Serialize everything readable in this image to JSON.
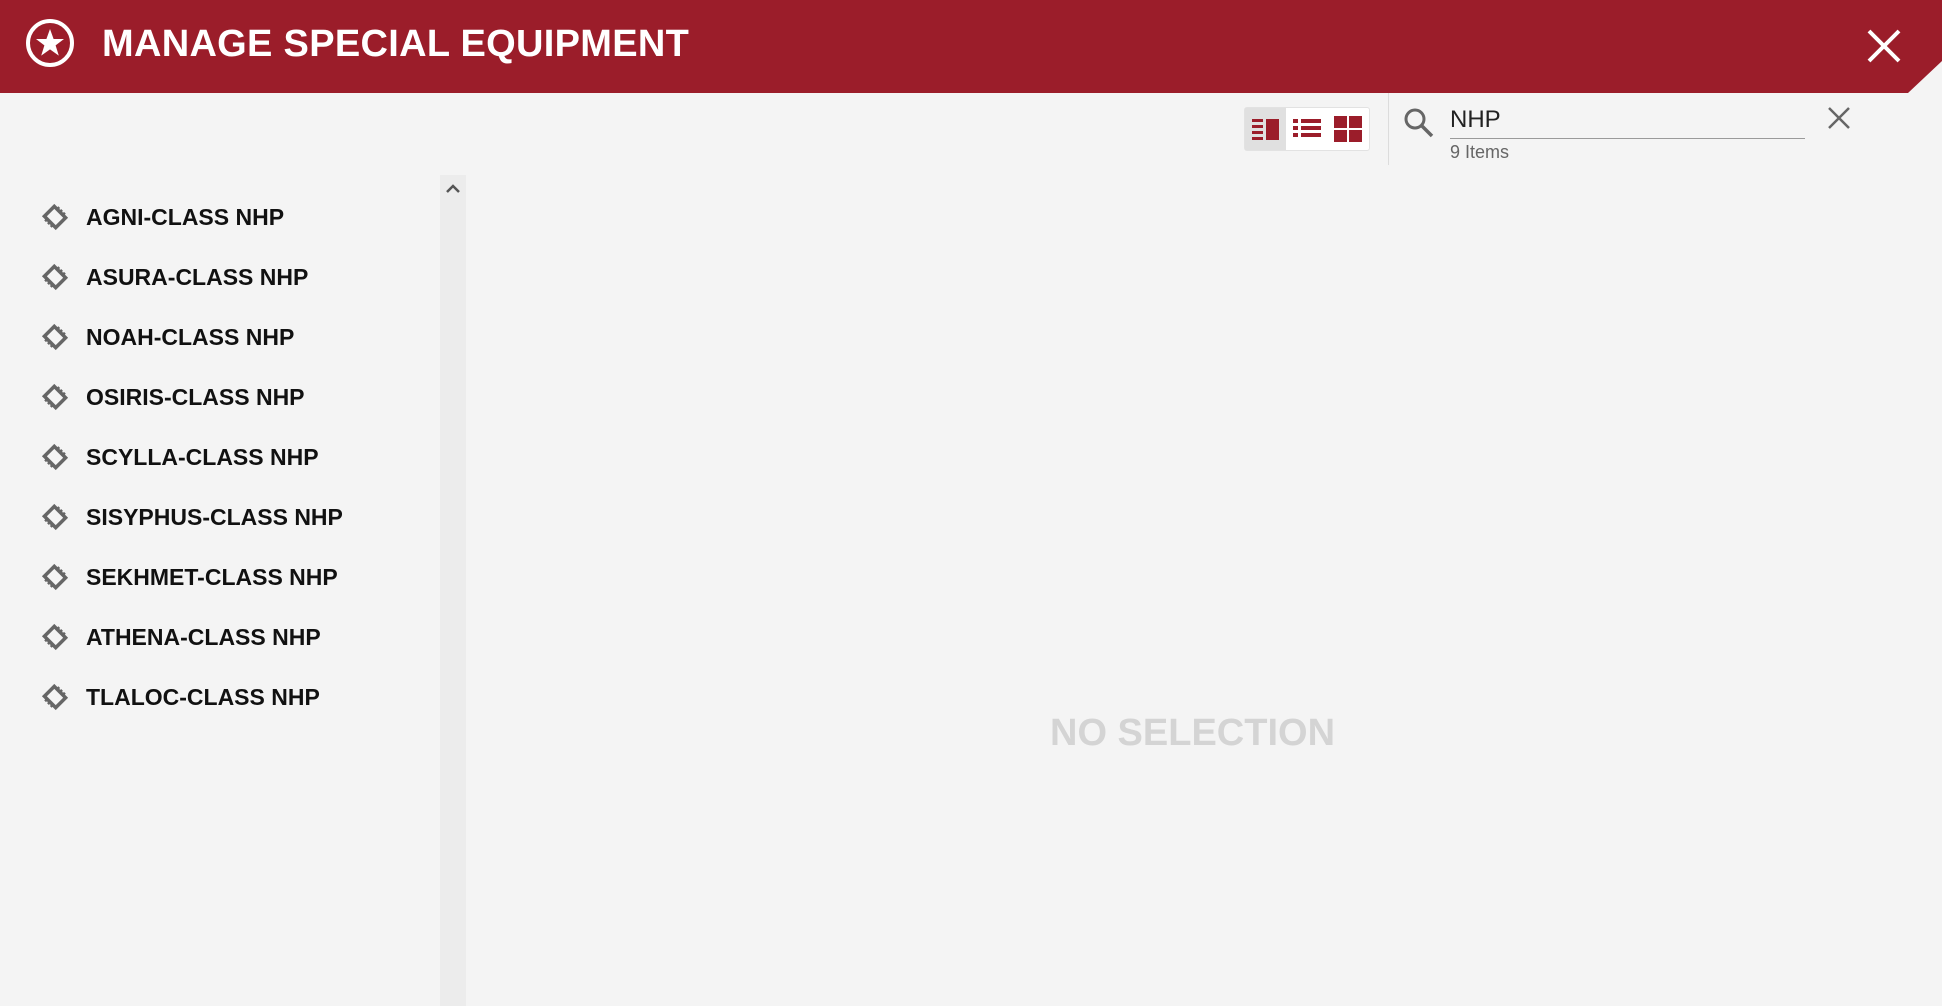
{
  "header": {
    "title": "MANAGE SPECIAL EQUIPMENT",
    "icon": "star-circle-icon",
    "close_icon": "close-icon",
    "color": "#9b1d2a"
  },
  "toolbar": {
    "views": [
      {
        "name": "detail-view",
        "icon": "detail-view-icon",
        "active": true
      },
      {
        "name": "list-view",
        "icon": "list-view-icon",
        "active": false
      },
      {
        "name": "grid-view",
        "icon": "grid-view-icon",
        "active": false
      }
    ]
  },
  "search": {
    "value": "NHP",
    "placeholder": "",
    "count_label": "9 Items"
  },
  "items": [
    {
      "label": "AGNI-CLASS NHP"
    },
    {
      "label": "ASURA-CLASS NHP"
    },
    {
      "label": "NOAH-CLASS NHP"
    },
    {
      "label": "OSIRIS-CLASS NHP"
    },
    {
      "label": "SCYLLA-CLASS NHP"
    },
    {
      "label": "SISYPHUS-CLASS NHP"
    },
    {
      "label": "SEKHMET-CLASS NHP"
    },
    {
      "label": "ATHENA-CLASS NHP"
    },
    {
      "label": "TLALOC-CLASS NHP"
    }
  ],
  "detail": {
    "empty_label": "NO SELECTION"
  }
}
